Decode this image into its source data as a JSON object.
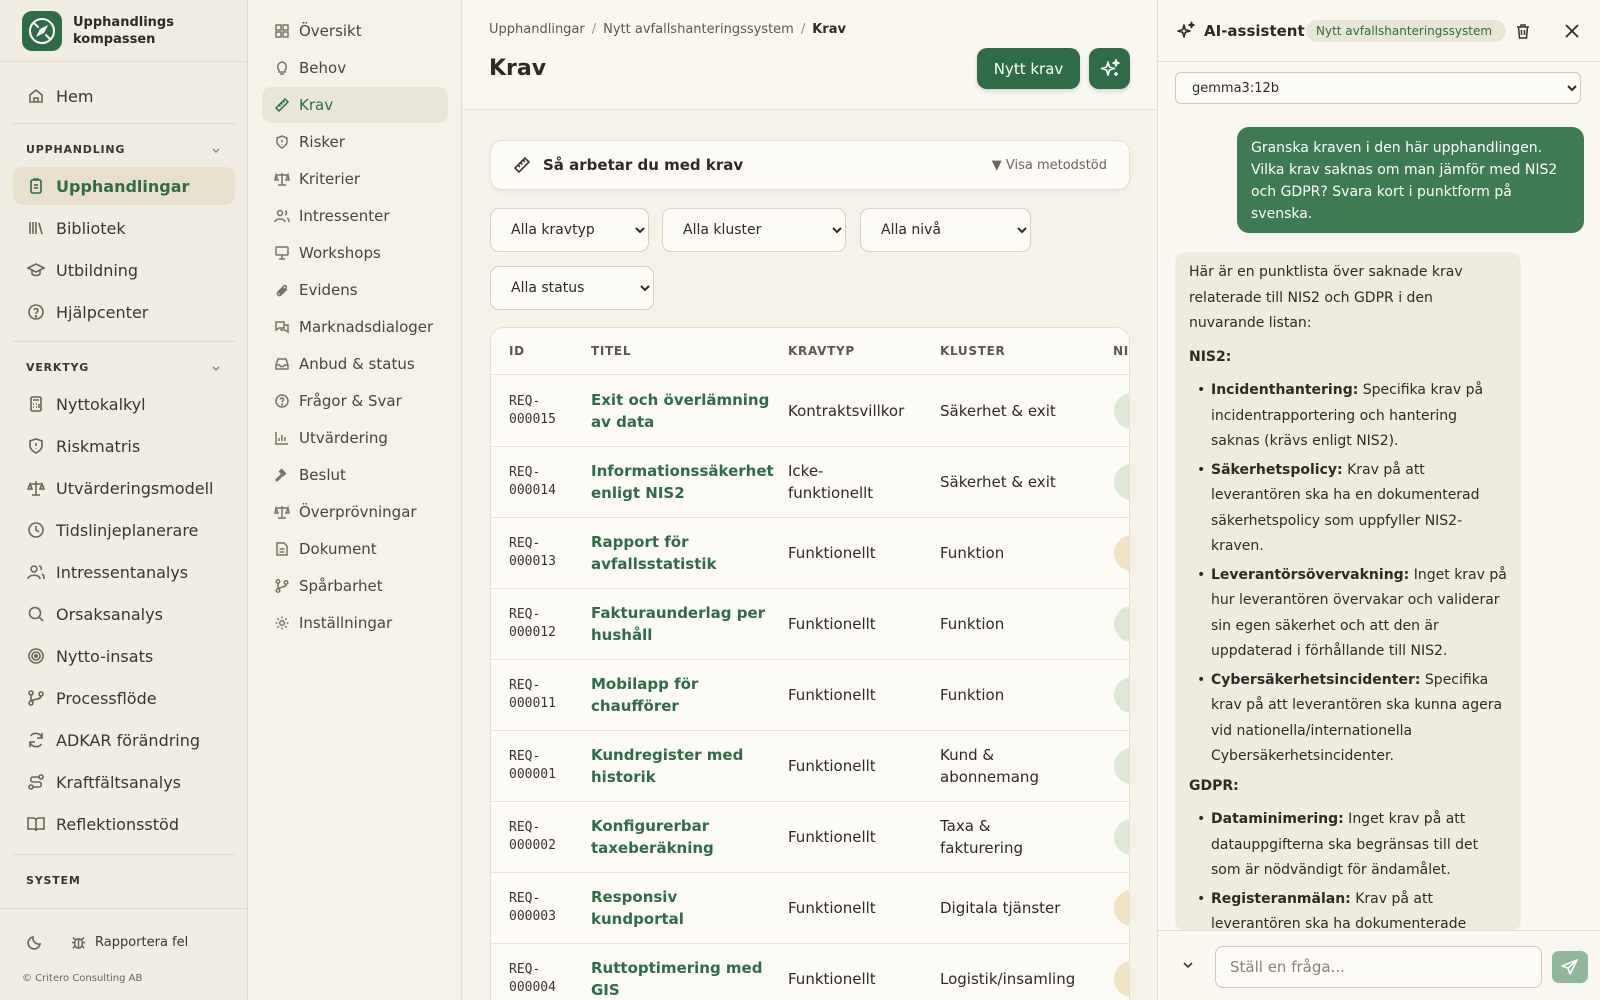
{
  "app": {
    "name_line1": "Upphandlings",
    "name_line2": "kompassen",
    "copyright": "© Critero Consulting AB",
    "report_label": "Rapportera fel"
  },
  "sidebar": {
    "home": "Hem",
    "sections": [
      {
        "title": "UPPHANDLING"
      },
      {
        "title": "VERKTYG"
      },
      {
        "title": "SYSTEM"
      }
    ],
    "upphandling_items": [
      "Upphandlingar",
      "Bibliotek",
      "Utbildning",
      "Hjälpcenter"
    ],
    "verktyg_items": [
      "Nyttokalkyl",
      "Riskmatris",
      "Utvärderingsmodell",
      "Tidslinjeplanerare",
      "Intressentanalys",
      "Orsaksanalys",
      "Nytto-insats",
      "Processflöde",
      "ADKAR förändring",
      "Kraftfältsanalys",
      "Reflektionsstöd"
    ]
  },
  "subnav": [
    "Översikt",
    "Behov",
    "Krav",
    "Risker",
    "Kriterier",
    "Intressenter",
    "Workshops",
    "Evidens",
    "Marknadsdialoger",
    "Anbud & status",
    "Frågor & Svar",
    "Utvärdering",
    "Beslut",
    "Överprövningar",
    "Dokument",
    "Spårbarhet",
    "Inställningar"
  ],
  "breadcrumb": [
    "Upphandlingar",
    "Nytt avfallshanteringssystem",
    "Krav"
  ],
  "page_title": "Krav",
  "new_button": "Nytt krav",
  "method": {
    "title": "Så arbetar du med krav",
    "toggle": "▼ Visa metodstöd"
  },
  "filters": [
    "Alla kravtyp",
    "Alla kluster",
    "Alla nivå",
    "Alla status"
  ],
  "table": {
    "headers": [
      "ID",
      "TITEL",
      "KRAVTYP",
      "KLUSTER",
      "NIV"
    ],
    "rows": [
      {
        "id": "REQ-000015",
        "title": "Exit och överlämning av data",
        "type": "Kontraktsvillkor",
        "cluster": "Säkerhet & exit",
        "level_color": "#dde8d6"
      },
      {
        "id": "REQ-000014",
        "title": "Informationssäkerhet enligt NIS2",
        "type": "Icke-funktionellt",
        "cluster": "Säkerhet & exit",
        "level_color": "#dde8d6"
      },
      {
        "id": "REQ-000013",
        "title": "Rapport för avfallsstatistik",
        "type": "Funktionellt",
        "cluster": "Funktion",
        "level_color": "#f2e3c4"
      },
      {
        "id": "REQ-000012",
        "title": "Fakturaunderlag per hushåll",
        "type": "Funktionellt",
        "cluster": "Funktion",
        "level_color": "#dde8d6"
      },
      {
        "id": "REQ-000011",
        "title": "Mobilapp för chaufförer",
        "type": "Funktionellt",
        "cluster": "Funktion",
        "level_color": "#dde8d6"
      },
      {
        "id": "REQ-000001",
        "title": "Kundregister med historik",
        "type": "Funktionellt",
        "cluster": "Kund & abonnemang",
        "level_color": "#dde8d6"
      },
      {
        "id": "REQ-000002",
        "title": "Konfigurerbar taxeberäkning",
        "type": "Funktionellt",
        "cluster": "Taxa & fakturering",
        "level_color": "#dde8d6"
      },
      {
        "id": "REQ-000003",
        "title": "Responsiv kundportal",
        "type": "Funktionellt",
        "cluster": "Digitala tjänster",
        "level_color": "#f2e3c4"
      },
      {
        "id": "REQ-000004",
        "title": "Ruttoptimering med GIS",
        "type": "Funktionellt",
        "cluster": "Logistik/insamling",
        "level_color": "#f2e3c4"
      }
    ]
  },
  "ai": {
    "title": "AI-assistent",
    "context": "Nytt avfallshanteringssystem",
    "model": "gemma3:12b",
    "user_message": "Granska kraven i den här upphandlingen. Vilka krav saknas om man jämför med NIS2 och GDPR? Svara kort i punktform på svenska.",
    "answer_intro": "Här är en punktlista över saknade krav relaterade till NIS2 och GDPR i den nuvarande listan:",
    "nis2_heading": "NIS2:",
    "nis2_points": [
      {
        "label": "Incidenthantering:",
        "text": " Specifika krav på incidentrapportering och hantering saknas (krävs enligt NIS2)."
      },
      {
        "label": "Säkerhetspolicy:",
        "text": " Krav på att leverantören ska ha en dokumenterad säkerhetspolicy som uppfyller NIS2-kraven."
      },
      {
        "label": "Leverantörsövervakning:",
        "text": " Inget krav på hur leverantören övervakar och validerar sin egen säkerhet och att den är uppdaterad i förhållande till NIS2."
      },
      {
        "label": "Cybersäkerhetsincidenter:",
        "text": " Specifika krav på att leverantören ska kunna agera vid nationella/internationella Cybersäkerhetsincidenter."
      }
    ],
    "gdpr_heading": "GDPR:",
    "gdpr_points": [
      {
        "label": "Dataminimering:",
        "text": " Inget krav på att datauppgifterna ska begränsas till det som är nödvändigt för ändamålet."
      },
      {
        "label": "Registeranmälan:",
        "text": " Krav på att leverantören ska ha dokumenterade rutiner för registeranmälan."
      }
    ],
    "input_placeholder": "Ställ en fråga..."
  }
}
